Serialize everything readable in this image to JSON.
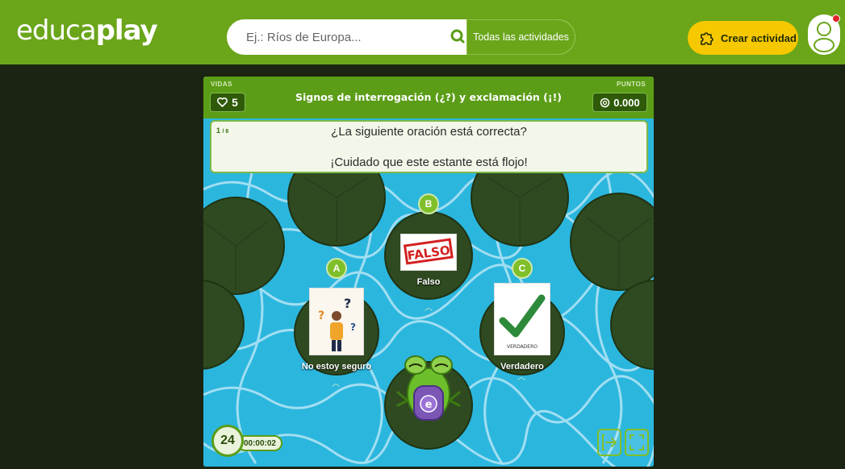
{
  "header": {
    "logo_a": "educa",
    "logo_b": "play",
    "search": {
      "placeholder": "Ej.: Ríos de Europa..."
    },
    "search_scope": "Todas las actividades",
    "create_label": "Crear actividad"
  },
  "game": {
    "lives_label": "VIDAS",
    "lives": "5",
    "title": "Signos de interrogación (¿?) y exclamación (¡!)",
    "points_label": "PUNTOS",
    "points": "0.000",
    "counter_current": "1",
    "counter_total": "/ 6",
    "question": "¿La siguiente oración está correcta?",
    "sentence": "¡Cuidado que este estante está flojo!",
    "options": [
      {
        "letter": "A",
        "label": "No estoy seguro"
      },
      {
        "letter": "B",
        "label": "Falso",
        "image_text": "FALSO"
      },
      {
        "letter": "C",
        "label": "Verdadero",
        "image_text": "VERDADERO"
      }
    ],
    "frog_letter": "e",
    "timer_seconds": "24",
    "elapsed": "00:00:02"
  },
  "colors": {
    "brand_green": "#6aa51a",
    "accent_yellow": "#f6c800",
    "water": "#29b8df",
    "lily_pad": "#2f4a20"
  }
}
